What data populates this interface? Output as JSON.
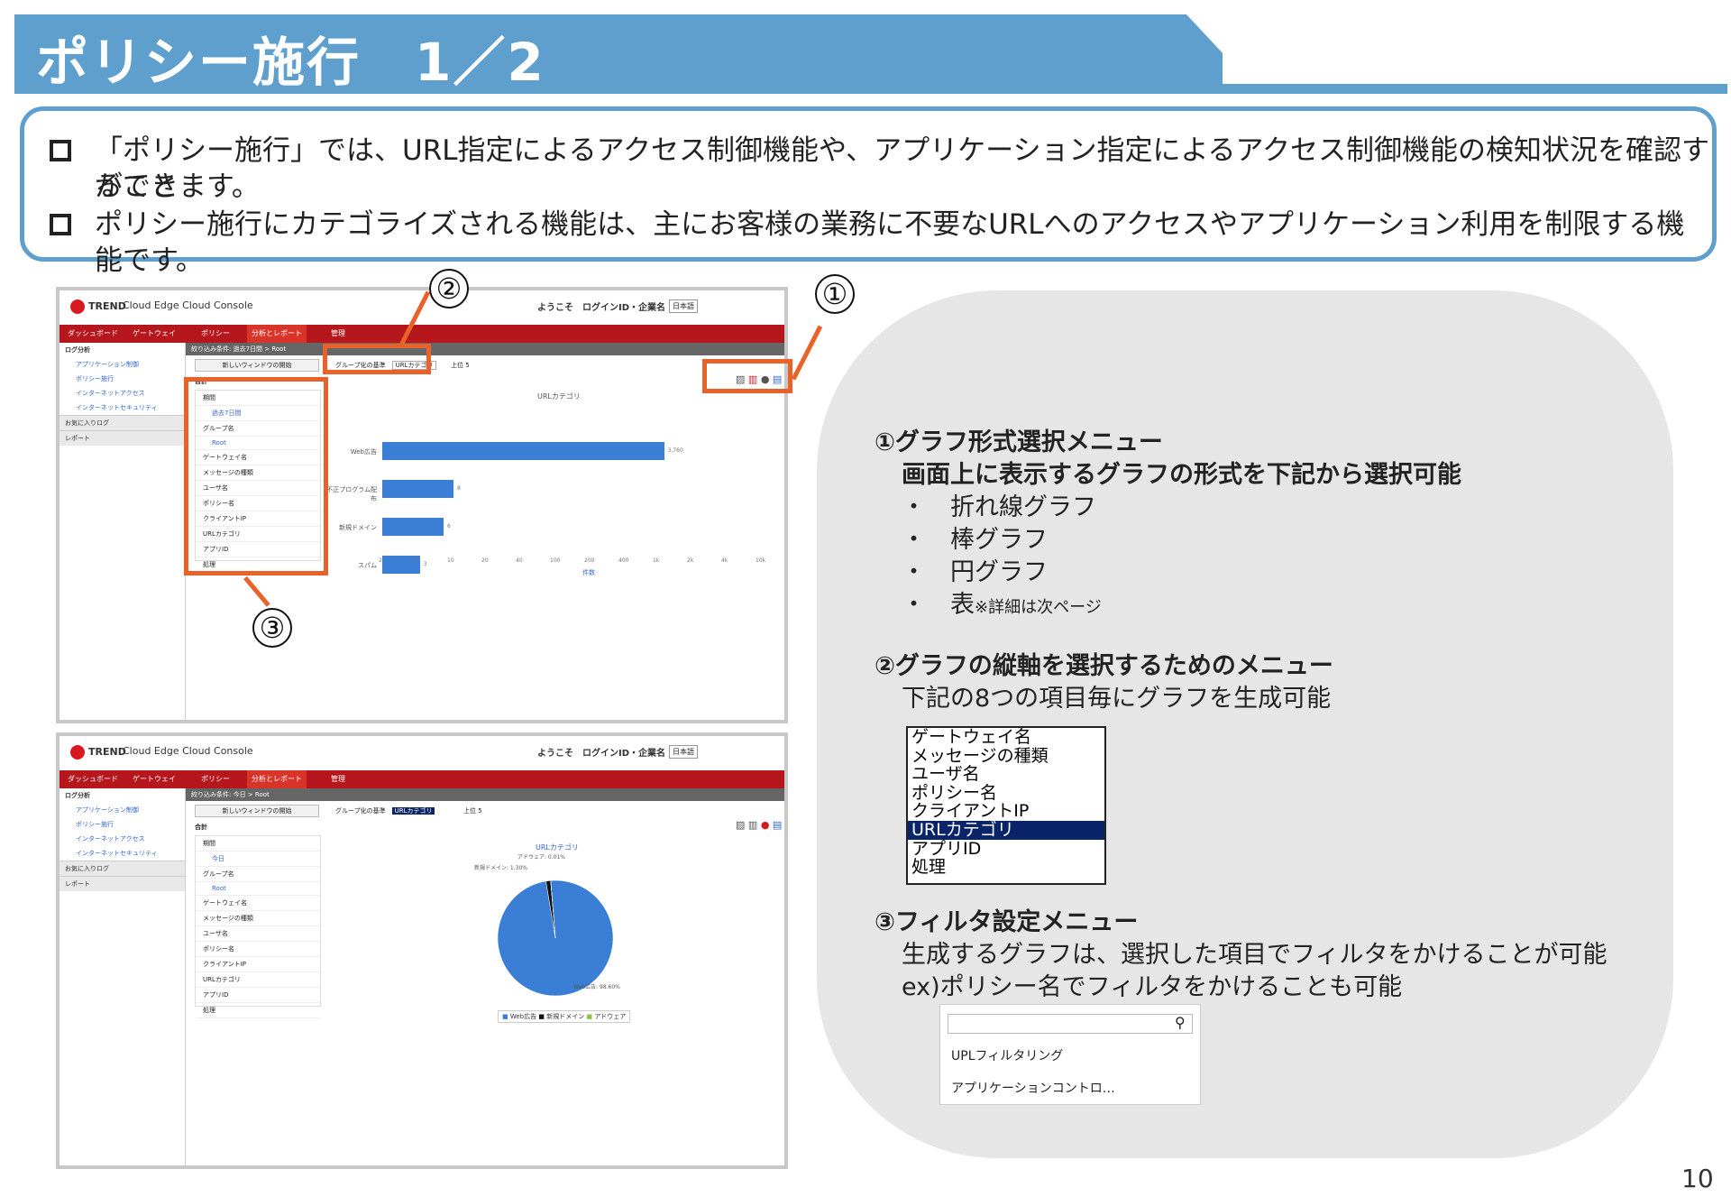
{
  "title": "ポリシー施行　1／2",
  "bullets": [
    "「ポリシー施行」では、URL指定によるアクセス制御機能や、アプリケーション指定によるアクセス制御機能の検知状況を確認すること",
    "ができます。",
    "ポリシー施行にカテゴライズされる機能は、主にお客様の業務に不要なURLへのアクセスやアプリケーション利用を制限する機能です。"
  ],
  "callouts": {
    "one": "①",
    "two": "②",
    "three": "③"
  },
  "screen": {
    "logo": "TREND",
    "console": "Cloud Edge Cloud Console",
    "user": "ようこそ　ログインID・企業名",
    "lang": "日本語",
    "nav": [
      "ダッシュボード",
      "ゲートウェイ",
      "ポリシー",
      "分析とレポート",
      "管理"
    ],
    "side": [
      "ログ分析",
      "アプリケーション制御",
      "ポリシー施行",
      "インターネットアクセス",
      "インターネットセキュリティ",
      "お気に入りログ",
      "レポート"
    ],
    "crumb1": "絞り込み条件: 過去7日間 > Root",
    "crumb2": "絞り込み条件: 今日 > Root",
    "new_window": "新しいウィンドウの開始",
    "group_label": "グループ化の基準",
    "group_value": "URLカテゴリ",
    "top_label": "上位 5",
    "total": "合計",
    "filters": [
      "期間",
      "過去7日間",
      "グループ名",
      "Root",
      "ゲートウェイ名",
      "メッセージの種類",
      "ユーザ名",
      "ポリシー名",
      "クライアントIP",
      "URLカテゴリ",
      "アプリID",
      "処理"
    ],
    "filters2": [
      "期間",
      "今日",
      "グループ名",
      "Root",
      "ゲートウェイ名",
      "メッセージの種類",
      "ユーザ名",
      "ポリシー名",
      "クライアントIP",
      "URLカテゴリ",
      "アプリID",
      "処理"
    ],
    "chart_title": "URLカテゴリ",
    "pie_title": "URLカテゴリ",
    "bar_labels": [
      "Web広告",
      "不正プログラム配布",
      "新規ドメイン",
      "スパム"
    ],
    "bar_values_text": [
      "3,760",
      "8",
      "6",
      "3"
    ],
    "axis_ticks": [
      "2",
      "4",
      "10",
      "20",
      "40",
      "100",
      "200",
      "400",
      "1k",
      "2k",
      "4k",
      "10k"
    ],
    "axis_label": "件数",
    "pie_labels": [
      "アドウェア: 0.01%",
      "新規ドメイン: 1.30%",
      "Web広告: 98.60%"
    ],
    "legend": [
      "Web広告",
      "新規ドメイン",
      "アドウェア"
    ]
  },
  "chart_data": [
    {
      "type": "bar",
      "title": "URLカテゴリ",
      "categories": [
        "Web広告",
        "不正プログラム配布",
        "新規ドメイン",
        "スパム"
      ],
      "values": [
        3760,
        8,
        6,
        3
      ],
      "xlabel": "件数",
      "scale": "log"
    },
    {
      "type": "pie",
      "title": "URLカテゴリ",
      "categories": [
        "Web広告",
        "新規ドメイン",
        "アドウェア"
      ],
      "values": [
        98.6,
        1.3,
        0.01
      ]
    }
  ],
  "right": {
    "h1": "①グラフ形式選択メニュー",
    "h1_sub": "画面上に表示するグラフの形式を下記から選択可能",
    "types": [
      "・　折れ線グラフ",
      "・　棒グラフ",
      "・　円グラフ",
      "・　表"
    ],
    "types_note": "※詳細は次ページ",
    "h2": "②グラフの縦軸を選択するためのメニュー",
    "h2_sub": "下記の8つの項目毎にグラフを生成可能",
    "dimensions": [
      "ゲートウェイ名",
      "メッセージの種類",
      "ユーザ名",
      "ポリシー名",
      "クライアントIP",
      "URLカテゴリ",
      "アプリID",
      "処理"
    ],
    "selected_dimension": "URLカテゴリ",
    "h3": "③フィルタ設定メニュー",
    "h3_sub1": "生成するグラフは、選択した項目でフィルタをかけることが可能",
    "h3_sub2": "ex)ポリシー名でフィルタをかけることも可能",
    "search_results": [
      "UPLフィルタリング",
      "アプリケーションコントロ…"
    ]
  },
  "page_number": "10",
  "colors": {
    "accent": "#5f9fcd",
    "highlight": "#e8622a",
    "nav": "#b5171c",
    "bar": "#3a7fd5"
  }
}
